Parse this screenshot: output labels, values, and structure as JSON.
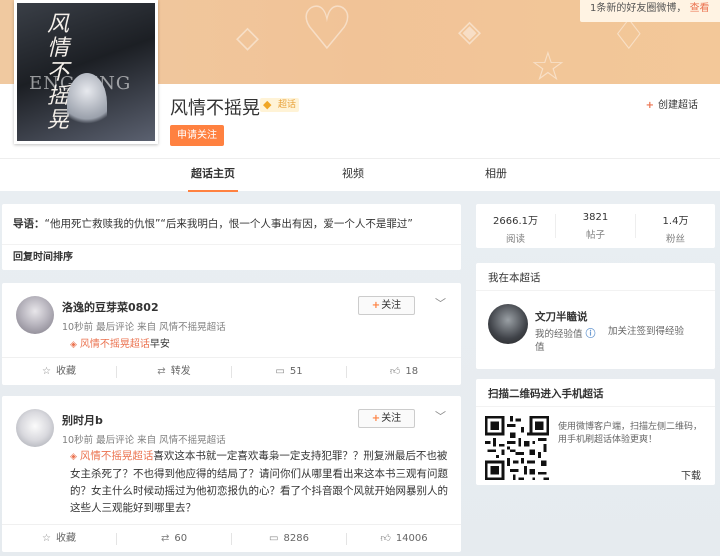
{
  "notice": {
    "text": "1条新的好友圈微博，",
    "link": "查看"
  },
  "cover": {
    "title": "风情不摇晃",
    "watermark": "ENGQING"
  },
  "topic": {
    "title": "风情不摇晃",
    "badge": "超话",
    "follow_label": "申请关注",
    "create_label": "创建超话"
  },
  "tabs": [
    {
      "label": "超话主页",
      "active": true
    },
    {
      "label": "视频",
      "active": false
    },
    {
      "label": "相册",
      "active": false
    }
  ],
  "guide": {
    "prefix": "导语：",
    "text": "“他用死亡救赎我的仇恨”“后来我明白，恨一个人事出有因，爱一个人不是罪过”",
    "sort": "回复时间排序"
  },
  "posts": [
    {
      "user": "洛逸的豆芽菜0802",
      "meta": "10秒前 最后评论 来自 风情不摇晃超话",
      "tag": "风情不摇晃超话",
      "text": "早安",
      "follow": "关注",
      "actions": {
        "fav": "收藏",
        "repost": "转发",
        "comment": "51",
        "like": "18"
      }
    },
    {
      "user": "别时月b",
      "meta": "10秒前 最后评论 来自 风情不摇晃超话",
      "tag": "风情不摇晃超话",
      "text": "喜欢这本书就一定喜欢毒枭一定支持犯罪？？刑复洲最后不也被女主杀死了？不也得到他应得的结局了？请问你们从哪里看出来这本书三观有问题的？女主什么时候动摇过为他初恋报仇的心？看了个抖音跟个风就开始网暴别人的这些人三观能好到哪里去？",
      "follow": "关注",
      "actions": {
        "fav": "收藏",
        "repost": "60",
        "comment": "8286",
        "like": "14006"
      }
    }
  ],
  "stats": [
    {
      "num": "2666.1万",
      "label": "阅读"
    },
    {
      "num": "3821",
      "label": "帖子"
    },
    {
      "num": "1.4万",
      "label": "粉丝"
    }
  ],
  "me": {
    "heading": "我在本超话",
    "name": "文刀半瞌说",
    "exp_label": "我的经验值",
    "exp_label2": "值",
    "hint": "加关注签到得经验"
  },
  "qr": {
    "heading": "扫描二维码进入手机超话",
    "desc": "使用微博客户端，扫描左侧二维码，用手机刷超话体验更爽！",
    "download": "下载"
  },
  "colors": {
    "accent": "#ff8140",
    "tag": "#eb7350",
    "badge": "#f0a624"
  }
}
